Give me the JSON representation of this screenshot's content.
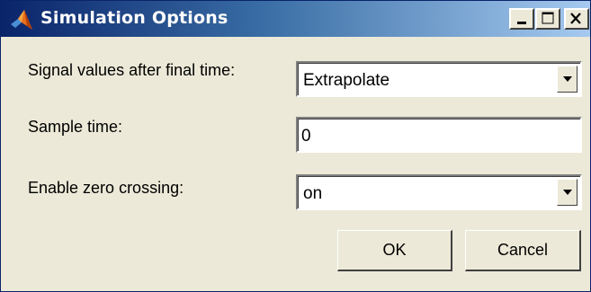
{
  "window": {
    "title": "Simulation Options",
    "icon": "matlab-logo-icon",
    "controls": {
      "minimize": "minimize-icon",
      "maximize": "maximize-icon",
      "close": "close-icon"
    }
  },
  "form": {
    "signal_values": {
      "label": "Signal values after final time:",
      "value": "Extrapolate"
    },
    "sample_time": {
      "label": "Sample time:",
      "value": "0"
    },
    "zero_crossing": {
      "label": "Enable zero crossing:",
      "value": "on"
    }
  },
  "buttons": {
    "ok": "OK",
    "cancel": "Cancel"
  },
  "colors": {
    "title_start": "#0a246a",
    "title_end": "#a6caf0",
    "dialog_bg": "#ece9d8",
    "matlab_orange": "#e8701a"
  }
}
